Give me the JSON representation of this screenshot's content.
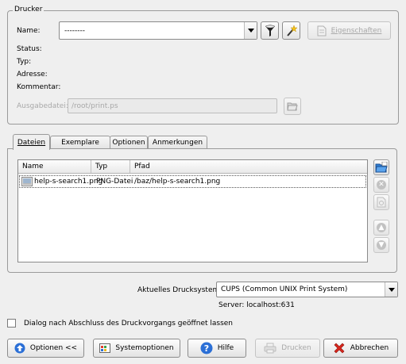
{
  "printer_group": {
    "title": "Drucker",
    "name_label": "Name:",
    "name_value": "--------",
    "properties_label": "Eigenschaften",
    "status_label": "Status:",
    "type_label": "Typ:",
    "address_label": "Adresse:",
    "comment_label": "Kommentar:",
    "output_file_label": "Ausgabedatei:",
    "output_file_value": "/root/print.ps"
  },
  "tabs": [
    {
      "label": "Dateien",
      "active": true
    },
    {
      "label": "Exemplare",
      "active": false
    },
    {
      "label": "Optionen",
      "active": false
    },
    {
      "label": "Anmerkungen",
      "active": false
    }
  ],
  "file_list": {
    "columns": [
      "Name",
      "Typ",
      "Pfad"
    ],
    "rows": [
      {
        "name": "help-s-search1.png",
        "type": "PNG-Datei",
        "path": "/baz/help-s-search1.png"
      }
    ]
  },
  "print_system": {
    "label": "Aktuelles Drucksystem:",
    "value": "CUPS (Common UNIX Print System)",
    "server": "Server: localhost:631"
  },
  "keep_dialog_checkbox": {
    "label": "Dialog nach Abschluss des Druckvorgangs geöffnet lassen",
    "checked": false
  },
  "buttons": {
    "options": "Optionen <<",
    "system_options": "Systemoptionen",
    "help": "Hilfe",
    "print": "Drucken",
    "cancel": "Abbrechen"
  },
  "icons": {
    "printer_filter": "filter-icon",
    "wizard": "wand-icon",
    "properties": "document-icon",
    "browse": "folder-open-icon",
    "add_file": "add-file-icon",
    "remove": "remove-icon",
    "preview": "preview-icon",
    "up": "up-arrow-icon",
    "down": "down-arrow-icon"
  },
  "colors": {
    "window_bg": "#efefef",
    "help_blue": "#2b6fd6",
    "cancel_red": "#d8261c"
  }
}
